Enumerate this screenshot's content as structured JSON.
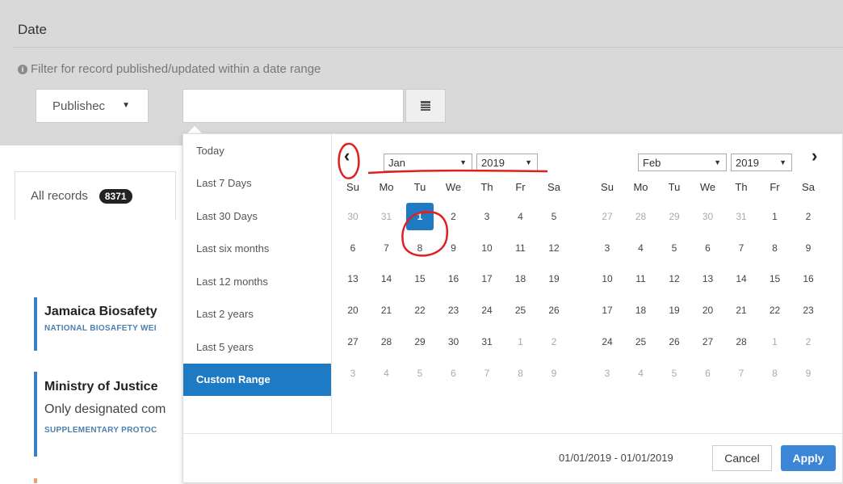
{
  "filter": {
    "title": "Date",
    "help_text": "Filter for record published/updated within a date range",
    "type_select": {
      "value": "Publishec"
    },
    "date_input": {
      "value": ""
    }
  },
  "records": {
    "tab_label": "All records",
    "count": "8371",
    "cards": [
      {
        "title": "Jamaica Biosafety",
        "tag": "NATIONAL BIOSAFETY WEI"
      },
      {
        "title": "Ministry of Justice",
        "text": "Only designated com",
        "tag": "SUPPLEMENTARY PROTOC"
      }
    ]
  },
  "picker": {
    "ranges": [
      "Today",
      "Last 7 Days",
      "Last 30 Days",
      "Last six months",
      "Last 12 months",
      "Last 2 years",
      "Last 5 years",
      "Custom Range"
    ],
    "active_range": "Custom Range",
    "weekdays": [
      "Su",
      "Mo",
      "Tu",
      "We",
      "Th",
      "Fr",
      "Sa"
    ],
    "left": {
      "month": "Jan",
      "year": "2019",
      "days": [
        [
          "30",
          "31",
          "1",
          "2",
          "3",
          "4",
          "5"
        ],
        [
          "6",
          "7",
          "8",
          "9",
          "10",
          "11",
          "12"
        ],
        [
          "13",
          "14",
          "15",
          "16",
          "17",
          "18",
          "19"
        ],
        [
          "20",
          "21",
          "22",
          "23",
          "24",
          "25",
          "26"
        ],
        [
          "27",
          "28",
          "29",
          "30",
          "31",
          "1",
          "2"
        ],
        [
          "3",
          "4",
          "5",
          "6",
          "7",
          "8",
          "9"
        ]
      ],
      "off": [
        [
          0,
          0
        ],
        [
          0,
          1
        ],
        [
          4,
          5
        ],
        [
          4,
          6
        ],
        [
          5,
          0
        ],
        [
          5,
          1
        ],
        [
          5,
          2
        ],
        [
          5,
          3
        ],
        [
          5,
          4
        ],
        [
          5,
          5
        ],
        [
          5,
          6
        ]
      ],
      "selected": [
        0,
        2
      ]
    },
    "right": {
      "month": "Feb",
      "year": "2019",
      "days": [
        [
          "27",
          "28",
          "29",
          "30",
          "31",
          "1",
          "2"
        ],
        [
          "3",
          "4",
          "5",
          "6",
          "7",
          "8",
          "9"
        ],
        [
          "10",
          "11",
          "12",
          "13",
          "14",
          "15",
          "16"
        ],
        [
          "17",
          "18",
          "19",
          "20",
          "21",
          "22",
          "23"
        ],
        [
          "24",
          "25",
          "26",
          "27",
          "28",
          "1",
          "2"
        ],
        [
          "3",
          "4",
          "5",
          "6",
          "7",
          "8",
          "9"
        ]
      ],
      "off": [
        [
          0,
          0
        ],
        [
          0,
          1
        ],
        [
          0,
          2
        ],
        [
          0,
          3
        ],
        [
          0,
          4
        ],
        [
          4,
          5
        ],
        [
          4,
          6
        ],
        [
          5,
          0
        ],
        [
          5,
          1
        ],
        [
          5,
          2
        ],
        [
          5,
          3
        ],
        [
          5,
          4
        ],
        [
          5,
          5
        ],
        [
          5,
          6
        ]
      ]
    },
    "range_text": "01/01/2019 - 01/01/2019",
    "cancel_label": "Cancel",
    "apply_label": "Apply",
    "colors": {
      "accent": "#1f7ac4",
      "annotation": "#e02020"
    }
  }
}
